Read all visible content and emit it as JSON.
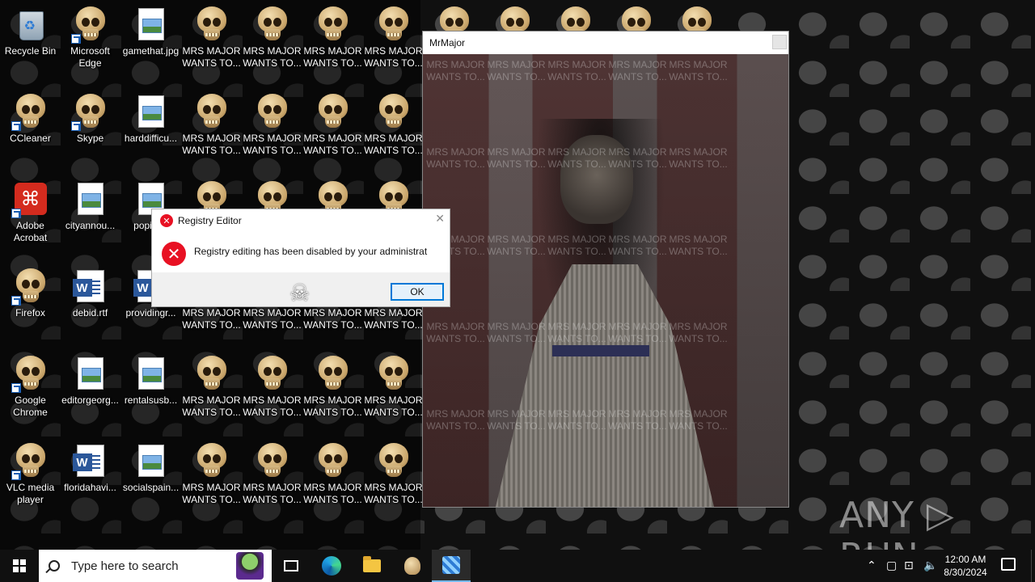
{
  "desktop": {
    "icons": [
      {
        "label": "Recycle Bin",
        "type": "recycle"
      },
      {
        "label": "Microsoft Edge",
        "type": "edge"
      },
      {
        "label": "gamethat.jpg",
        "type": "image"
      },
      {
        "label": "CCleaner",
        "type": "ccleaner"
      },
      {
        "label": "Skype",
        "type": "skype"
      },
      {
        "label": "harddifficu...",
        "type": "image"
      },
      {
        "label": "Adobe Acrobat",
        "type": "acrobat"
      },
      {
        "label": "cityannou...",
        "type": "image"
      },
      {
        "label": "popint...",
        "type": "image"
      },
      {
        "label": "Firefox",
        "type": "firefox"
      },
      {
        "label": "debid.rtf",
        "type": "word"
      },
      {
        "label": "providingr...",
        "type": "word"
      },
      {
        "label": "Google Chrome",
        "type": "chrome"
      },
      {
        "label": "editorgeorg...",
        "type": "image"
      },
      {
        "label": "rentalsusb...",
        "type": "image"
      },
      {
        "label": "VLC media player",
        "type": "vlc"
      },
      {
        "label": "floridahavi...",
        "type": "word"
      },
      {
        "label": "socialspain...",
        "type": "image"
      }
    ],
    "skull_icon_label": "MRS MAJOR WANTS TO..."
  },
  "mrmajor_window": {
    "title": "MrMajor"
  },
  "registry_dialog": {
    "title": "Registry Editor",
    "message": "Registry editing has been disabled by your administrat",
    "ok_label": "OK"
  },
  "watermark": "ANY ▷ RUN",
  "taskbar": {
    "search_placeholder": "Type here to search",
    "time": "12:00 AM",
    "date": "8/30/2024"
  }
}
